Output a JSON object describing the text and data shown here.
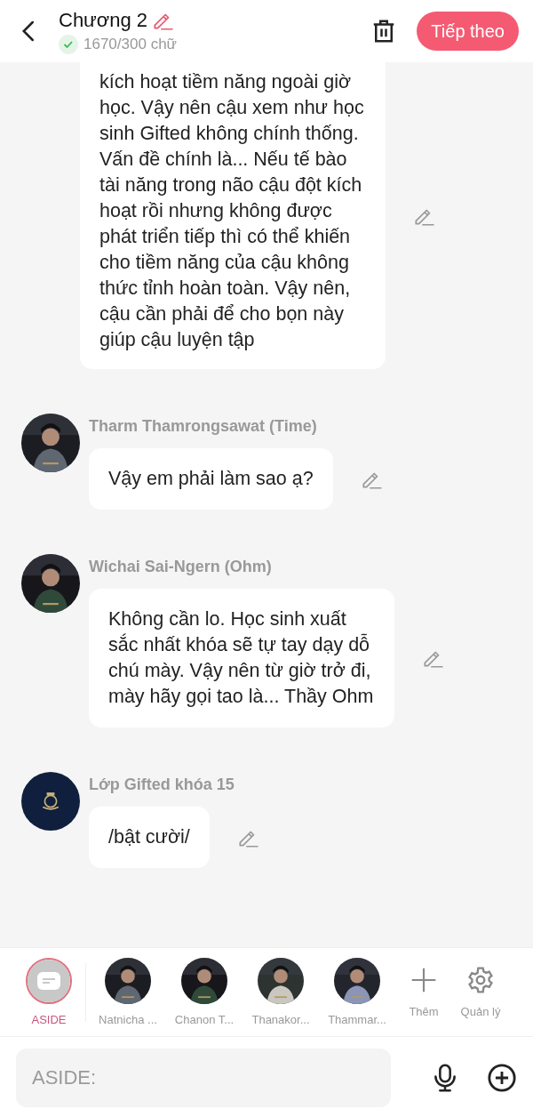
{
  "header": {
    "title": "Chương 2",
    "word_count": "1670/300 chữ",
    "next_button": "Tiếp theo"
  },
  "messages": [
    {
      "text": "kích hoạt tiềm năng ngoài giờ học. Vậy nên cậu xem như học sinh Gifted không chính thống. Vấn đề chính là... Nếu tế bào tài năng trong não cậu đột kích hoạt rồi nhưng không được phát triển tiếp thì có thể khiến cho tiềm năng của cậu không thức tỉnh hoàn toàn. Vậy nên, cậu cần phải để cho bọn này giúp cậu luyện tập"
    },
    {
      "sender": "Tharm Thamrongsawat (Time)",
      "text": "Vậy em phải làm sao ạ?"
    },
    {
      "sender": "Wichai Sai-Ngern (Ohm)",
      "text": "Không cần lo. Học sinh xuất sắc nhất khóa sẽ tự tay dạy dỗ chú mày. Vậy nên từ giờ trở đi, mày hãy gọi tao là... Thầy Ohm"
    },
    {
      "sender": "Lớp Gifted khóa 15",
      "text": "/bật cười/"
    }
  ],
  "characters": [
    {
      "name": "ASIDE",
      "kind": "aside",
      "selected": true
    },
    {
      "name": "Natnicha ...",
      "kind": "picture",
      "selected": false
    },
    {
      "name": "Chanon T...",
      "kind": "picture",
      "selected": false
    },
    {
      "name": "Thanakor...",
      "kind": "picture",
      "selected": false
    },
    {
      "name": "Thammar...",
      "kind": "picture",
      "selected": false
    }
  ],
  "actions": [
    {
      "label": "Thêm",
      "kind": "add"
    },
    {
      "label": "Quản lý",
      "kind": "settings"
    }
  ],
  "input": {
    "placeholder": "ASIDE:"
  }
}
